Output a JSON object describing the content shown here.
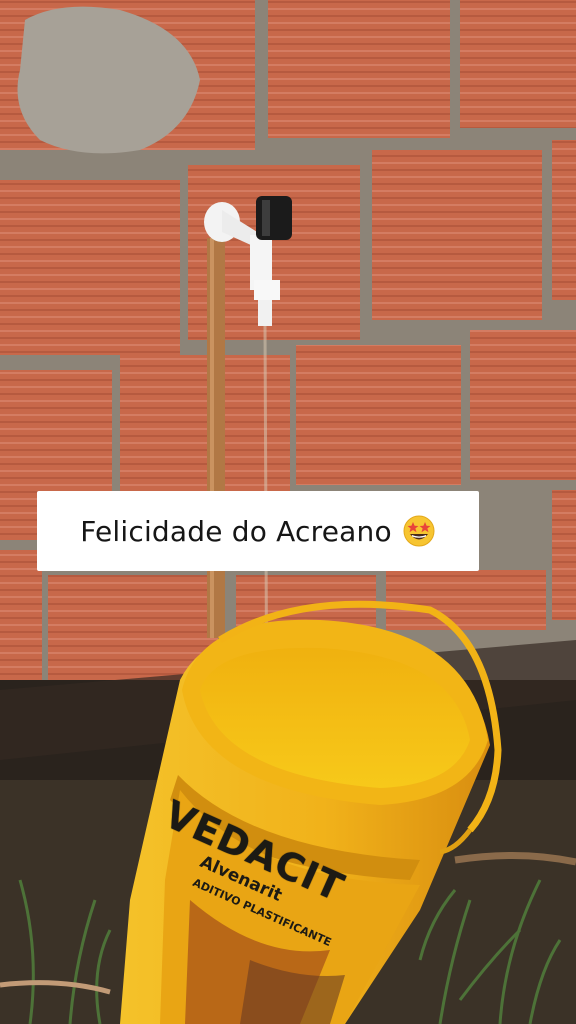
{
  "caption": {
    "text": "Felicidade do Acreano",
    "emoji": "star-struck-emoji-icon"
  },
  "bucket": {
    "brand": "VEDACIT",
    "product": "Alvenarit",
    "subtext": "ADITIVO PLASTIFICANTE"
  },
  "colors": {
    "brick": "#c8684a",
    "mortar": "#8c8478",
    "bucket": "#f6c21a",
    "caption_bg": "#ffffff"
  }
}
